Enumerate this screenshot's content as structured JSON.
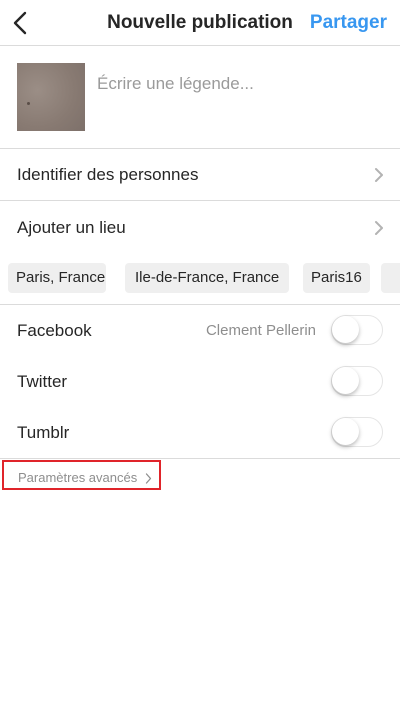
{
  "header": {
    "title": "Nouvelle publication",
    "share_label": "Partager"
  },
  "caption": {
    "placeholder": "Écrire une légende..."
  },
  "options": {
    "tag_people_label": "Identifier des personnes",
    "add_location_label": "Ajouter un lieu"
  },
  "location_suggestions": [
    "Paris, France",
    "Ile-de-France, France",
    "Paris16"
  ],
  "sharing": {
    "facebook": {
      "label": "Facebook",
      "account": "Clement Pellerin",
      "enabled": false
    },
    "twitter": {
      "label": "Twitter",
      "enabled": false
    },
    "tumblr": {
      "label": "Tumblr",
      "enabled": false
    }
  },
  "advanced_settings_label": "Paramètres avancés",
  "colors": {
    "accent": "#3897f0",
    "highlight_border": "#e0242a",
    "divider": "#dbdbdb"
  },
  "icons": {
    "back": "chevron-left-icon",
    "row_arrow": "chevron-right-icon"
  }
}
